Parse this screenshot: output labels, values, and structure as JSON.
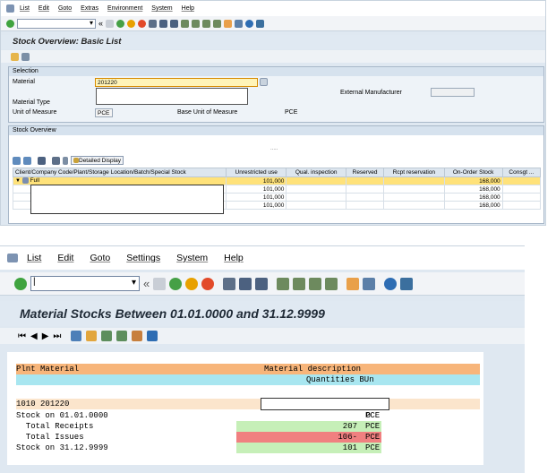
{
  "win1": {
    "menu": [
      "List",
      "Edit",
      "Goto",
      "Extras",
      "Environment",
      "System",
      "Help"
    ],
    "title": "Stock Overview: Basic List",
    "selection": {
      "header": "Selection",
      "material_label": "Material",
      "material_value": "201220",
      "material_type_label": "Material Type",
      "uom_label": "Unit of Measure",
      "uom_value": "PCE",
      "base_uom_label": "Base Unit of Measure",
      "base_uom_value": "PCE",
      "ext_manufacturer_label": "External Manufacturer"
    },
    "stock_overview": {
      "header": "Stock Overview",
      "detailed_display": "Detailed Display",
      "dots": ".....",
      "columns": [
        "Client/Company Code/Plant/Storage Location/Batch/Special Stock",
        "Unrestricted use",
        "Qual. inspection",
        "Reserved",
        "Rcpt reservation",
        "On-Order Stock",
        "Consgt ..."
      ],
      "rows": [
        {
          "name": "Full",
          "unrestricted": "101,000",
          "on_order": "168,000"
        },
        {
          "name": "",
          "unrestricted": "101,000",
          "on_order": "168,000"
        },
        {
          "name": "",
          "unrestricted": "101,000",
          "on_order": "168,000"
        },
        {
          "name": "",
          "unrestricted": "101,000",
          "on_order": "168,000"
        }
      ]
    }
  },
  "win2": {
    "menu": [
      "List",
      "Edit",
      "Goto",
      "Settings",
      "System",
      "Help"
    ],
    "command_value": "|",
    "title": "Material Stocks Between 01.01.0000 and 31.12.9999",
    "report": {
      "hdr_plant_material": "Plnt Material",
      "hdr_description": "Material description",
      "hdr_quantities": "Quantities BUn",
      "plant": "1010",
      "material": "201220",
      "lines": [
        {
          "label": "Stock on 01.01.0000",
          "qty": "0",
          "unit": "PCE",
          "color": "none"
        },
        {
          "label": "  Total Receipts",
          "qty": "207",
          "unit": "PCE",
          "color": "#c6efb8"
        },
        {
          "label": "  Total Issues",
          "qty": "106-",
          "unit": "PCE",
          "color": "#f08080"
        },
        {
          "label": "Stock on 31.12.9999",
          "qty": "101",
          "unit": "PCE",
          "color": "#c6efb8"
        }
      ]
    }
  },
  "colors": {
    "header_orange": "#f7b57a",
    "header_cyan": "#a8e6f0",
    "row_beige": "#fbe5cc",
    "selected_row": "#ffe27a"
  }
}
